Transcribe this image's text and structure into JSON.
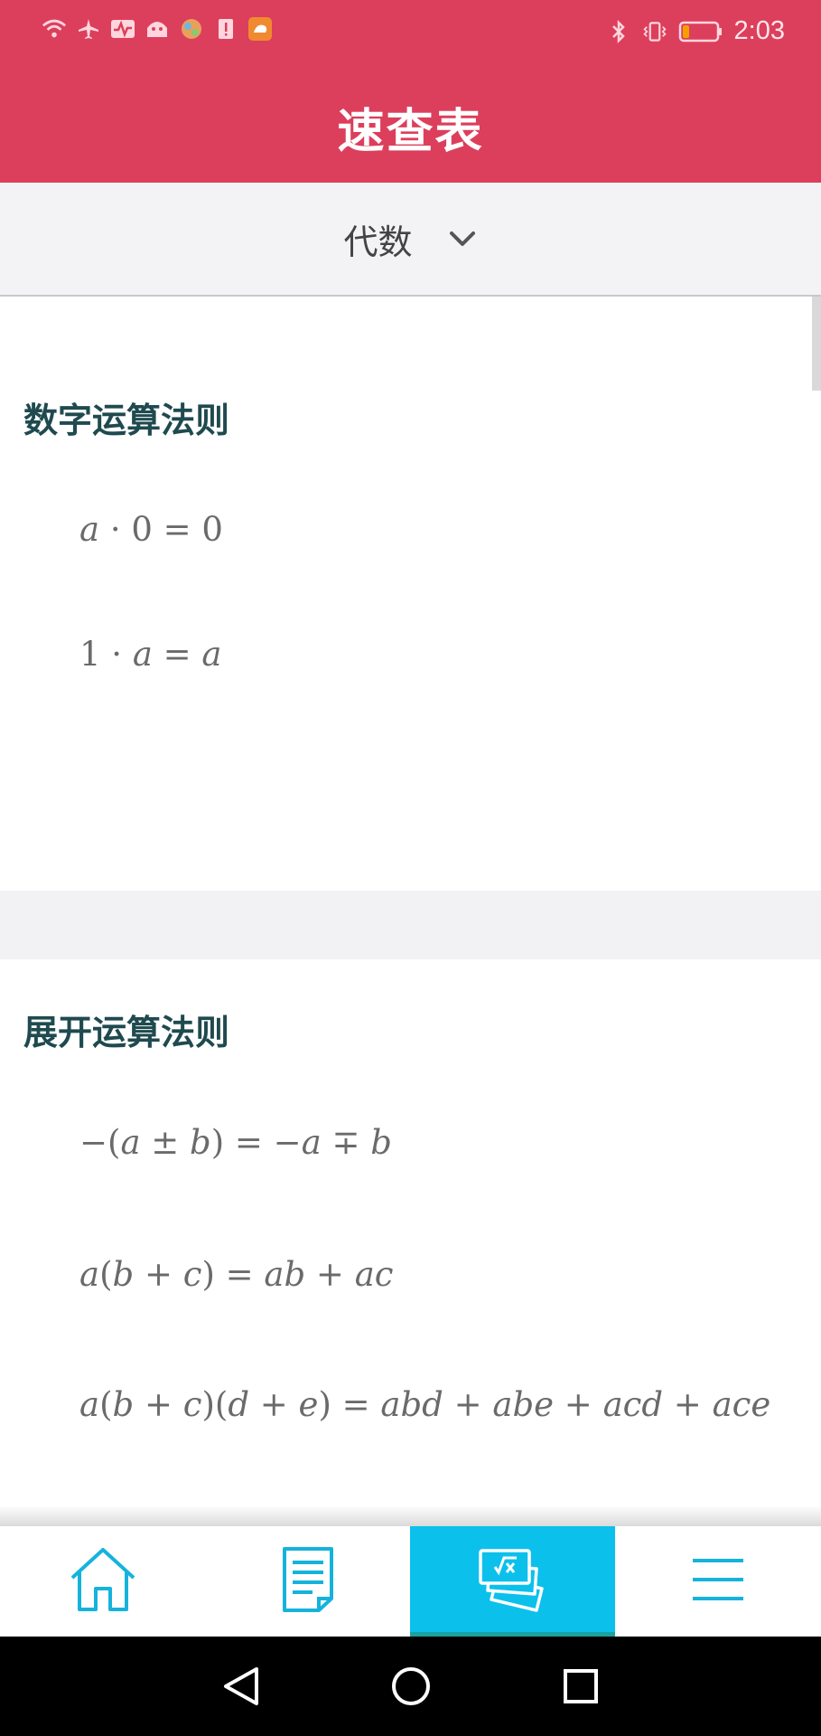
{
  "status_bar": {
    "time": "2:03",
    "left_icons": [
      "wifi-icon",
      "airplane-icon",
      "activity-icon",
      "android-icon",
      "globe-icon",
      "alert-icon",
      "uc-browser-icon"
    ],
    "right_icons": [
      "bluetooth-icon",
      "vibrate-icon",
      "battery-icon"
    ]
  },
  "app_bar": {
    "title": "速查表"
  },
  "selector": {
    "label": "代数"
  },
  "sections": [
    {
      "title": "数字运算法则",
      "formulas": [
        "a·0 = 0",
        "1·a = a"
      ]
    },
    {
      "title": "展开运算法则",
      "formulas": [
        "−(a ± b) = −a ∓ b",
        "a(b + c) = ab + ac",
        "a(b + c)(d + e) = abd + abe + acd + ace"
      ]
    }
  ],
  "bottom_nav": {
    "items": [
      "home-icon",
      "document-icon",
      "cheatsheet-cards-icon",
      "menu-icon"
    ],
    "active_index": 2
  },
  "colors": {
    "app_bar": "#dc3f5c",
    "active_tab": "#0cc0ec",
    "icon": "#15b3dc",
    "section_title": "#1f4a4f"
  }
}
